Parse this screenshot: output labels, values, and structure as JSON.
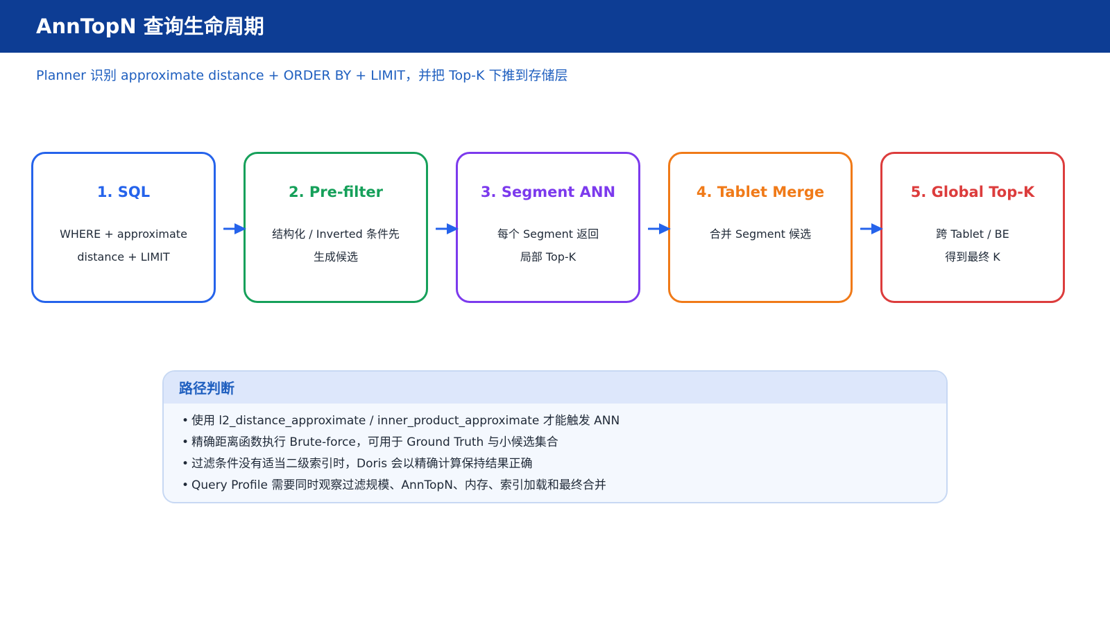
{
  "header": {
    "title": "AnnTopN 查询生命周期"
  },
  "subtitle": "Planner 识别 approximate distance + ORDER BY + LIMIT，并把 Top-K 下推到存储层",
  "stages": [
    {
      "title": "1. SQL",
      "lines": [
        "WHERE + approximate",
        "distance + LIMIT"
      ],
      "color": "#2563eb"
    },
    {
      "title": "2. Pre-filter",
      "lines": [
        "结构化 / Inverted 条件先",
        "生成候选"
      ],
      "color": "#16a05a"
    },
    {
      "title": "3. Segment ANN",
      "lines": [
        "每个 Segment 返回",
        "局部 Top-K"
      ],
      "color": "#7c3aed"
    },
    {
      "title": "4. Tablet Merge",
      "lines": [
        "合并 Segment 候选",
        ""
      ],
      "color": "#f07a18"
    },
    {
      "title": "5. Global Top-K",
      "lines": [
        "跨 Tablet / BE",
        "得到最终 K"
      ],
      "color": "#dc3c3c"
    }
  ],
  "arrow_color": "#2563eb",
  "panel": {
    "title": "路径判断",
    "bullet_symbol": "•",
    "bullets": [
      "使用 l2_distance_approximate / inner_product_approximate 才能触发 ANN",
      "精确距离函数执行 Brute-force，可用于 Ground Truth 与小候选集合",
      "过滤条件没有适当二级索引时，Doris 会以精确计算保持结果正确",
      "Query Profile 需要同时观察过滤规模、AnnTopN、内存、索引加载和最终合并"
    ]
  }
}
